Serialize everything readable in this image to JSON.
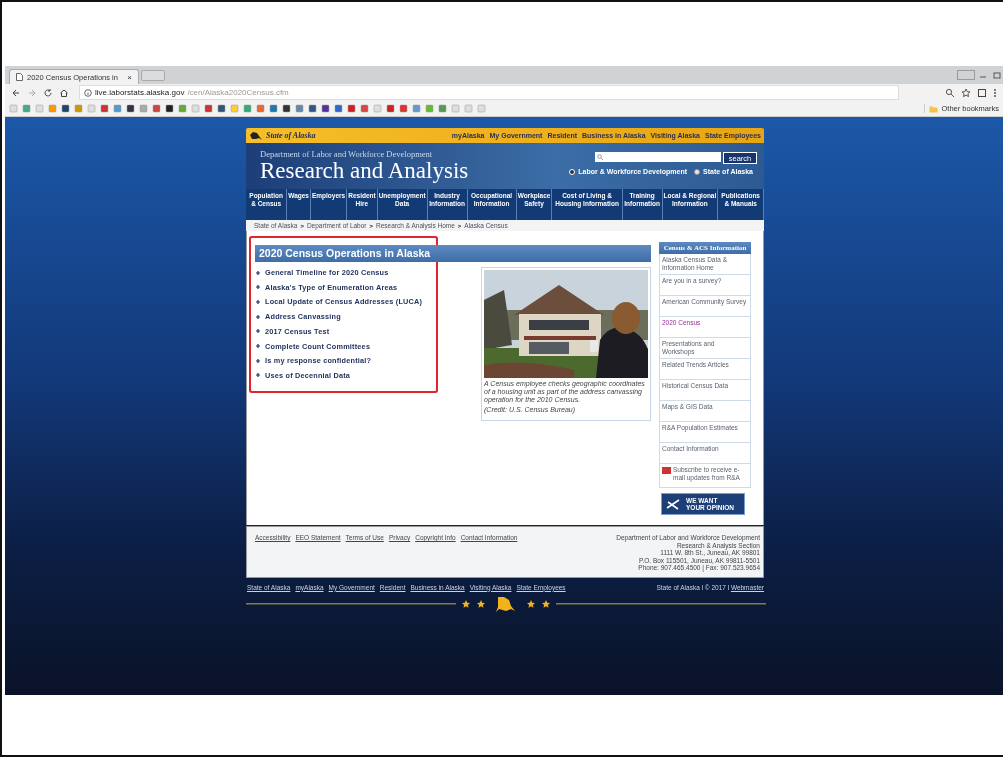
{
  "browser": {
    "tab_title": "2020 Census Operations in",
    "tab_close": "×",
    "url_host": "live.laborstats.alaska.gov",
    "url_path": "/cen/Alaska2020Census.cfm",
    "other_bookmarks": "Other bookmarks"
  },
  "state_bar": {
    "logo_text": "State of Alaska",
    "links": [
      "myAlaska",
      "My Government",
      "Resident",
      "Business in Alaska",
      "Visiting Alaska",
      "State Employees"
    ]
  },
  "header": {
    "department": "Department of Labor and Workforce Development",
    "title": "Research and Analysis",
    "search_button": "search",
    "scopes": [
      {
        "label": "Labor & Workforce Development",
        "selected": true
      },
      {
        "label": "State of Alaska",
        "selected": false
      }
    ]
  },
  "nav": [
    "Population & Census",
    "Wages",
    "Employers",
    "Resident Hire",
    "Unemployment Data",
    "Industry Information",
    "Occupational Information",
    "Workplace Safety",
    "Cost of Living & Housing Information",
    "Training Information",
    "Local & Regional Information",
    "Publications & Manuals"
  ],
  "breadcrumb": [
    {
      "kind": "link",
      "text": "State of Alaska"
    },
    {
      "kind": "separator",
      "text": ">"
    },
    {
      "kind": "link",
      "text": "Department of Labor"
    },
    {
      "kind": "separator",
      "text": ">"
    },
    {
      "kind": "link",
      "text": "Research & Analysis Home"
    },
    {
      "kind": "separator",
      "text": ">"
    },
    {
      "kind": "link",
      "text": "Alaska Census"
    }
  ],
  "main": {
    "heading": "2020 Census Operations in Alaska",
    "links": [
      "General Timeline for 2020 Census",
      "Alaska's Type of Enumeration Areas",
      "Local Update of Census Addresses (LUCA)",
      "Address Canvassing",
      "2017 Census Test",
      "Complete Count Committees",
      "Is my response confidential?",
      "Uses of Decennial Data"
    ]
  },
  "photo": {
    "kind": "picture",
    "caption": "A Census employee checks geographic coordinates of a housing unit as part of the address canvassing operation for the 2010 Census.",
    "credit": "(Credit: U.S. Census Bureau)"
  },
  "sidebar": {
    "heading": "Census & ACS Information",
    "items": [
      {
        "label": "Alaska Census Data & Information Home",
        "selected": false
      },
      {
        "label": "Are you in a survey?",
        "selected": false
      },
      {
        "label": "American Community Survey",
        "selected": false
      },
      {
        "label": "2020 Census",
        "selected": true
      },
      {
        "label": "Presentations and Workshops",
        "selected": false
      },
      {
        "label": "Related Trends Articles",
        "selected": false
      },
      {
        "label": "Historical Census Data",
        "selected": false
      },
      {
        "label": "Maps & GIS Data",
        "selected": false
      },
      {
        "label": "R&A Population Estimates",
        "selected": false
      },
      {
        "label": "Contact Information",
        "selected": false
      }
    ],
    "subscribe": "Subscribe to receive e-mail updates from R&A",
    "opinion": [
      "WE WANT",
      "YOUR OPINION"
    ]
  },
  "footer": {
    "links": [
      "Accessibility",
      "EEO Statement",
      "Terms of Use",
      "Privacy",
      "Copyright Info",
      "Contact Information"
    ],
    "address": [
      "Department of Labor and Workforce Development",
      "Research & Analysis Section",
      "1111 W. 8th St., Juneau, AK 99801",
      "P.O. Box 115501, Juneau, AK 99811-5501",
      "Phone: 907.465.4500 | Fax: 907.523.9654"
    ]
  },
  "bottom": {
    "links": [
      "State of Alaska",
      "myAlaska",
      "My Government",
      "Resident",
      "Business in Alaska",
      "Visiting Alaska",
      "State Employees"
    ],
    "right": [
      "State of Alaska",
      "© 2017",
      "Webmaster"
    ]
  }
}
